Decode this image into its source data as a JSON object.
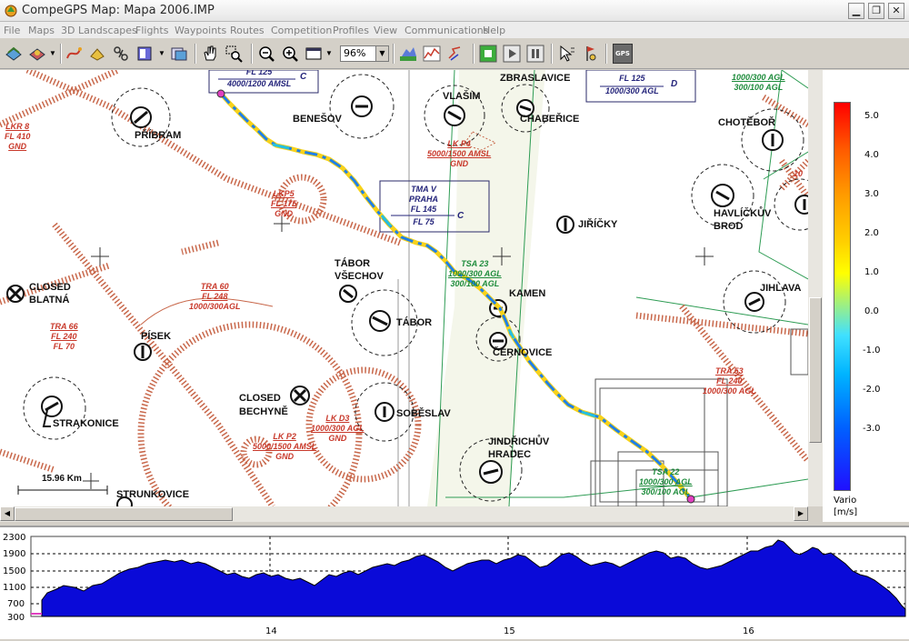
{
  "window": {
    "title": "CompeGPS Map: Mapa 2006.IMP",
    "controls": [
      "minimize",
      "maximize",
      "close"
    ]
  },
  "menu": [
    "File",
    "Maps",
    "3D Landscapes",
    "Flights",
    "Waypoints",
    "Routes",
    "Competition",
    "Profiles",
    "View",
    "Communications",
    "Help"
  ],
  "toolbar": {
    "zoom_value": "96%",
    "gps_label": "GPS"
  },
  "map": {
    "places": [
      "PŘÍBRAM",
      "BENEŠOV",
      "VLAŠIM",
      "ZBRASLAVICE",
      "CHABEŘICE",
      "CHOTĚBOŘ",
      "JIŘÍČKY",
      "HAVLÍČKŮV",
      "BROD",
      "JIHLAVA",
      "TÁBOR",
      "VŠECHOV",
      "KAMEN",
      "ČERNOVICE",
      "PÍSEK",
      "CLOSED",
      "BLATNÁ",
      "STRAKONICE",
      "CLOSED",
      "BECHYNĚ",
      "SOBĚSLAV",
      "JINDŘICHŮV",
      "HRADEC",
      "STRUNKOVICE"
    ],
    "airspaces": [
      {
        "name": "LKR 8",
        "upper": "FL 410",
        "lower": "GND",
        "color": "red"
      },
      {
        "name": "LKP5",
        "upper": "FL 175",
        "lower": "GND",
        "color": "red"
      },
      {
        "name": "LK P4",
        "upper": "5000/1500 AMSL",
        "lower": "GND",
        "color": "red"
      },
      {
        "name": "TMA V",
        "upper": "PRAHA",
        "mid": "FL 145",
        "lower": "FL 75",
        "class": "C",
        "color": "blue"
      },
      {
        "name": "TSA 23",
        "upper": "1000/300 AGL",
        "lower": "300/100 AGL",
        "color": "green"
      },
      {
        "name": "TRA 60",
        "upper": "FL 248",
        "lower": "1000/300AGL",
        "color": "red"
      },
      {
        "name": "TRA 66",
        "upper": "FL 240",
        "lower": "FL 70",
        "color": "red"
      },
      {
        "name": "LK D3",
        "upper": "1000/300 AGL",
        "lower": "GND",
        "color": "red"
      },
      {
        "name": "LK P2",
        "upper": "5000/1500 AMSL",
        "lower": "GND",
        "color": "red"
      },
      {
        "name": "TRA 53",
        "upper": "FL 240",
        "lower": "1000/300 AGL",
        "color": "red"
      },
      {
        "name": "TSA 22",
        "upper": "1000/300 AGL",
        "lower": "300/100 AGL",
        "color": "green"
      },
      {
        "name": "FL 125",
        "lower": "1000/300 AGL",
        "class": "D",
        "color": "blue"
      },
      {
        "name": "",
        "upper": "1000/300 AGL",
        "lower": "300/100 AGL",
        "color": "green"
      },
      {
        "name": "",
        "upper": "FL 125",
        "lower": "4000/1200 AMSL",
        "class": "C",
        "color": "blue"
      },
      {
        "name": "",
        "upper": "10",
        "color": "red"
      }
    ],
    "scale_label": "15.96 Km"
  },
  "legend": {
    "ticks": [
      "5.0",
      "4.0",
      "3.0",
      "2.0",
      "1.0",
      "0.0",
      "-1.0",
      "-2.0",
      "-3.0"
    ],
    "title": "Vario",
    "unit": "[m/s]"
  },
  "profile": {
    "y_ticks": [
      "2300",
      "1900",
      "1500",
      "1100",
      "700",
      "300"
    ],
    "x_ticks": [
      "14",
      "15",
      "16"
    ],
    "fill_color": "#0a0ad8"
  }
}
